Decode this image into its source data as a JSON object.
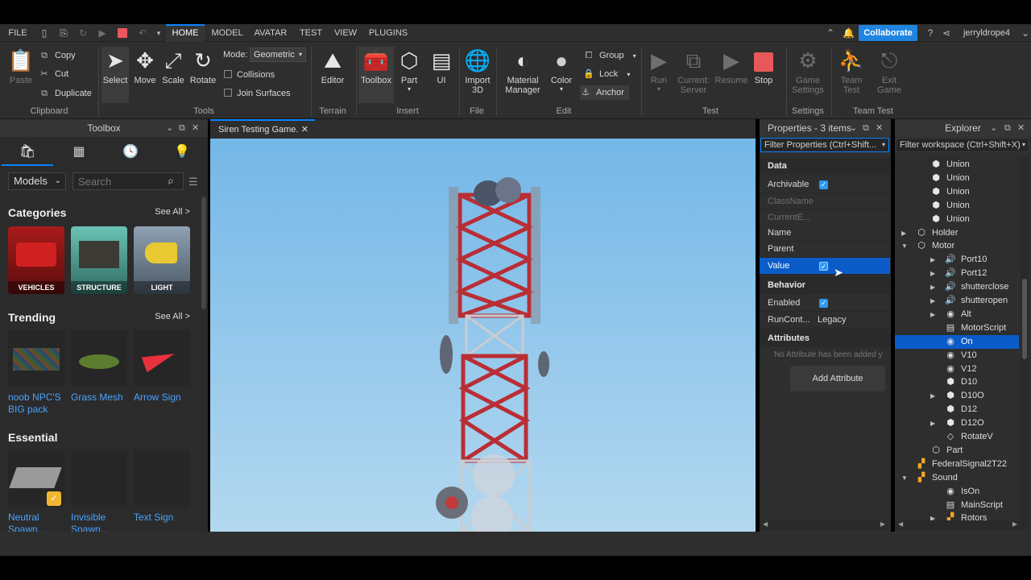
{
  "menu": {
    "file": "FILE",
    "tabs": [
      "HOME",
      "MODEL",
      "AVATAR",
      "TEST",
      "VIEW",
      "PLUGINS"
    ],
    "active_tab": "HOME",
    "collaborate": "Collaborate",
    "username": "jerryldrope4"
  },
  "ribbon": {
    "clipboard": {
      "paste": "Paste",
      "copy": "Copy",
      "cut": "Cut",
      "duplicate": "Duplicate",
      "group": "Clipboard"
    },
    "tools": {
      "select": "Select",
      "move": "Move",
      "scale": "Scale",
      "rotate": "Rotate",
      "mode_label": "Mode:",
      "mode_value": "Geometric",
      "collisions": "Collisions",
      "join_surfaces": "Join Surfaces",
      "group": "Tools"
    },
    "terrain": {
      "editor": "Editor",
      "group": "Terrain"
    },
    "insert": {
      "toolbox": "Toolbox",
      "part": "Part",
      "ui": "UI",
      "group": "Insert"
    },
    "file": {
      "import": "Import",
      "import2": "3D",
      "group": "File"
    },
    "edit": {
      "material": "Material",
      "material2": "Manager",
      "color": "Color",
      "group_btn": "Group",
      "lock": "Lock",
      "anchor": "Anchor",
      "group": "Edit"
    },
    "test": {
      "run": "Run",
      "current": "Current:",
      "server": "Server",
      "resume": "Resume",
      "stop": "Stop",
      "group": "Test"
    },
    "settings": {
      "game": "Game",
      "settings": "Settings",
      "group": "Settings"
    },
    "teamtest": {
      "team": "Team",
      "test": "Test",
      "exit": "Exit",
      "game": "Game",
      "group": "Team Test"
    }
  },
  "toolbox": {
    "title": "Toolbox",
    "dropdown": "Models",
    "search_placeholder": "Search",
    "categories_title": "Categories",
    "see_all": "See All >",
    "categories": [
      "VEHICLES",
      "STRUCTURE",
      "LIGHT"
    ],
    "trending_title": "Trending",
    "trending": [
      "noob  NPC'S BIG pack",
      "Grass Mesh",
      "Arrow Sign"
    ],
    "essential_title": "Essential",
    "essential": [
      "Neutral Spawn...",
      "Invisible Spawn...",
      "Text Sign"
    ]
  },
  "viewport": {
    "tab": "Siren Testing Game."
  },
  "properties": {
    "title": "Properties - 3 items",
    "filter": "Filter Properties (Ctrl+Shift...",
    "data_cat": "Data",
    "rows": [
      {
        "name": "Archivable"
      },
      {
        "name": "ClassName"
      },
      {
        "name": "CurrentE..."
      },
      {
        "name": "Name"
      },
      {
        "name": "Parent"
      },
      {
        "name": "Value"
      }
    ],
    "behavior_cat": "Behavior",
    "enabled": "Enabled",
    "runcontext": "RunCont...",
    "runcontext_value": "Legacy",
    "attributes_cat": "Attributes",
    "no_attr": "No Attribute has been added y",
    "add_attr": "Add Attribute"
  },
  "explorer": {
    "title": "Explorer",
    "filter": "Filter workspace (Ctrl+Shift+X)",
    "items": [
      {
        "label": "Union",
        "icon": "union-icon"
      },
      {
        "label": "Union",
        "icon": "union-icon"
      },
      {
        "label": "Union",
        "icon": "union-icon"
      },
      {
        "label": "Union",
        "icon": "union-icon"
      },
      {
        "label": "Union",
        "icon": "union-icon"
      },
      {
        "label": "Holder",
        "icon": "model-icon"
      },
      {
        "label": "Motor",
        "icon": "model-icon"
      },
      {
        "label": "Port10",
        "icon": "sound-icon"
      },
      {
        "label": "Port12",
        "icon": "sound-icon"
      },
      {
        "label": "shutterclose",
        "icon": "sound-icon"
      },
      {
        "label": "shutteropen",
        "icon": "sound-icon"
      },
      {
        "label": "Alt",
        "icon": "boolvalue-icon"
      },
      {
        "label": "MotorScript",
        "icon": "script-icon"
      },
      {
        "label": "On",
        "icon": "boolvalue-icon"
      },
      {
        "label": "V10",
        "icon": "boolvalue-icon"
      },
      {
        "label": "V12",
        "icon": "boolvalue-icon"
      },
      {
        "label": "D10",
        "icon": "union-icon"
      },
      {
        "label": "D10O",
        "icon": "union-icon"
      },
      {
        "label": "D12",
        "icon": "union-icon"
      },
      {
        "label": "D12O",
        "icon": "union-icon"
      },
      {
        "label": "RotateV",
        "icon": "diamond-icon"
      },
      {
        "label": "Part",
        "icon": "part-icon"
      },
      {
        "label": "FederalSignal2T22",
        "icon": "folder-model-icon"
      },
      {
        "label": "Sound",
        "icon": "folder-model-icon"
      },
      {
        "label": "IsOn",
        "icon": "boolvalue-icon"
      },
      {
        "label": "MainScript",
        "icon": "script-icon"
      },
      {
        "label": "Rotors",
        "icon": "folder-model-icon"
      }
    ]
  },
  "colors": {
    "accent": "#0a84ff",
    "selection": "#0b5bc9",
    "stop": "#e8585a",
    "link": "#4aa3ff"
  }
}
